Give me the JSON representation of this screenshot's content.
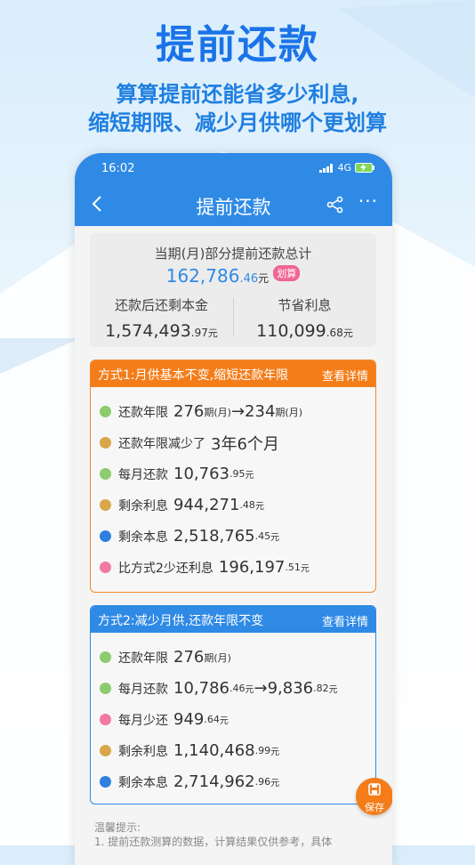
{
  "promo": {
    "title": "提前还款",
    "subtitle_line1": "算算提前还能省多少利息,",
    "subtitle_line2": "缩短期限、减少月供哪个更划算"
  },
  "statusbar": {
    "time": "16:02",
    "network": "4G"
  },
  "navbar": {
    "title": "提前还款",
    "back_icon": "chevron-left-icon",
    "share_icon": "share-icon",
    "more_label": "···"
  },
  "summary": {
    "label": "当期(月)部分提前还款总计",
    "total_int": "162,786",
    "total_dec": ".46",
    "total_unit": "元",
    "badge": "划算",
    "left_label": "还款后还剩本金",
    "left_int": "1,574,493",
    "left_dec": ".97",
    "left_unit": "元",
    "right_label": "节省利息",
    "right_int": "110,099",
    "right_dec": ".68",
    "right_unit": "元"
  },
  "plan1": {
    "title": "方式1:月供基本不变,缩短还款年限",
    "detail": "查看详情",
    "rows": [
      {
        "label": "还款年限",
        "v1": "276",
        "s1": "期(月)",
        "arrow": "→",
        "v2": "234",
        "s2": "期(月)"
      },
      {
        "label": "还款年限减少了",
        "v1": "3年6个月"
      },
      {
        "label": "每月还款",
        "v1": "10,763",
        "s1": ".95",
        "u1": "元"
      },
      {
        "label": "剩余利息",
        "v1": "944,271",
        "s1": ".48",
        "u1": "元"
      },
      {
        "label": "剩余本息",
        "v1": "2,518,765",
        "s1": ".45",
        "u1": "元"
      },
      {
        "label": "比方式2少还利息",
        "v1": "196,197",
        "s1": ".51",
        "u1": "元"
      }
    ]
  },
  "plan2": {
    "title": "方式2:减少月供,还款年限不变",
    "detail": "查看详情",
    "rows": [
      {
        "label": "还款年限",
        "v1": "276",
        "s1": "期(月)"
      },
      {
        "label": "每月还款",
        "v1": "10,786",
        "s1": ".46",
        "u1": "元",
        "arrow": "→",
        "v2": "9,836",
        "s2": ".82",
        "u2": "元"
      },
      {
        "label": "每月少还",
        "v1": "949",
        "s1": ".64",
        "u1": "元"
      },
      {
        "label": "剩余利息",
        "v1": "1,140,468",
        "s1": ".99",
        "u1": "元"
      },
      {
        "label": "剩余本息",
        "v1": "2,714,962",
        "s1": ".96",
        "u1": "元"
      }
    ]
  },
  "save_button": {
    "label": "保存"
  },
  "tips": {
    "title": "温馨提示:",
    "line1": "1. 提前还款测算的数据，计算结果仅供参考，具体"
  },
  "colors": {
    "green": "#8bcc6e",
    "gold": "#d9a74a",
    "blue": "#2f7fe0",
    "pink": "#f07aa0",
    "orange": "#f47d1a"
  }
}
